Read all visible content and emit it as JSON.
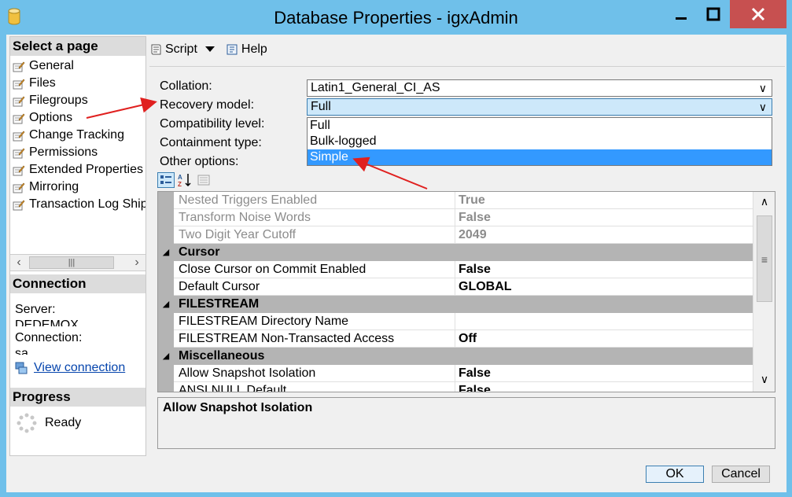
{
  "window": {
    "title": "Database Properties - igxAdmin"
  },
  "left_pane": {
    "select_page_header": "Select a page",
    "pages": [
      {
        "label": "General"
      },
      {
        "label": "Files"
      },
      {
        "label": "Filegroups"
      },
      {
        "label": "Options"
      },
      {
        "label": "Change Tracking"
      },
      {
        "label": "Permissions"
      },
      {
        "label": "Extended Properties"
      },
      {
        "label": "Mirroring"
      },
      {
        "label": "Transaction Log Shipping"
      }
    ],
    "connection_header": "Connection",
    "server_label": "Server:",
    "server_value": "DEDEMOX",
    "connection_label": "Connection:",
    "connection_value": "sa",
    "view_connection_link": "View connection",
    "progress_header": "Progress",
    "progress_status": "Ready"
  },
  "toolbar": {
    "script_label": "Script",
    "help_label": "Help"
  },
  "options": {
    "collation_label": "Collation:",
    "collation_value": "Latin1_General_CI_AS",
    "recovery_model_label": "Recovery model:",
    "recovery_model_value": "Full",
    "compatibility_label": "Compatibility level:",
    "containment_label": "Containment type:",
    "other_options_label": "Other options:",
    "recovery_dropdown_options": [
      "Full",
      "Bulk-logged",
      "Simple"
    ],
    "recovery_dropdown_selected": "Simple"
  },
  "property_grid": {
    "rows": [
      {
        "name": "Nested Triggers Enabled",
        "value": "True"
      },
      {
        "name": "Transform Noise Words",
        "value": "False"
      },
      {
        "name": "Two Digit Year Cutoff",
        "value": "2049"
      }
    ],
    "cursor_category": "Cursor",
    "cursor_rows": [
      {
        "name": "Close Cursor on Commit Enabled",
        "value": "False"
      },
      {
        "name": "Default Cursor",
        "value": "GLOBAL"
      }
    ],
    "filestream_category": "FILESTREAM",
    "filestream_rows": [
      {
        "name": "FILESTREAM Directory Name",
        "value": ""
      },
      {
        "name": "FILESTREAM Non-Transacted Access",
        "value": "Off"
      }
    ],
    "misc_category": "Miscellaneous",
    "misc_rows": [
      {
        "name": "Allow Snapshot Isolation",
        "value": "False"
      },
      {
        "name": "ANSI NULL Default",
        "value": "False"
      }
    ]
  },
  "description": {
    "title": "Allow Snapshot Isolation"
  },
  "buttons": {
    "ok_label": "OK",
    "cancel_label": "Cancel"
  },
  "colors": {
    "title_bar": "#6fc0ea",
    "close_button": "#c75050",
    "selection": "#3399ff",
    "annotation_arrow": "#e0201f"
  }
}
